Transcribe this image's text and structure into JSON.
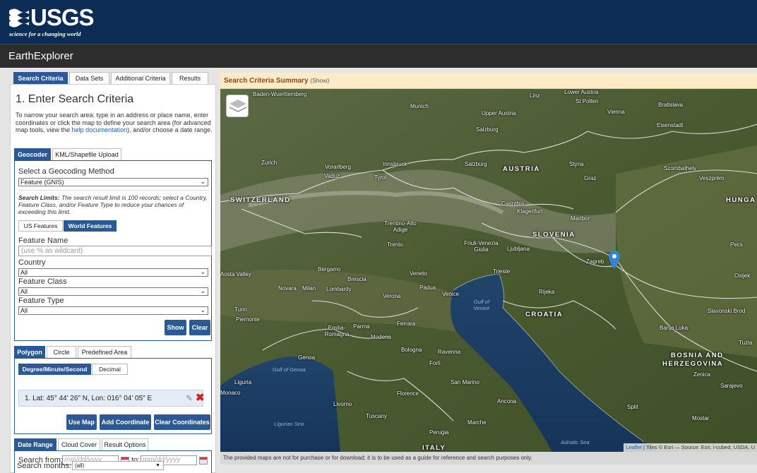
{
  "header": {
    "logo_text": "USGS",
    "logo_tagline": "science for a changing world",
    "app_title": "EarthExplorer"
  },
  "tabs": [
    {
      "label": "Search Criteria",
      "active": true
    },
    {
      "label": "Data Sets",
      "active": false
    },
    {
      "label": "Additional Criteria",
      "active": false
    },
    {
      "label": "Results",
      "active": false
    }
  ],
  "criteria": {
    "heading": "1. Enter Search Criteria",
    "intro_pre": "To narrow your search area: type in an address or place name, enter coordinates or click the map to define your search area (for advanced map tools, view the ",
    "intro_link": "help documentation",
    "intro_post": "), and/or choose a date range."
  },
  "geo_tabs": [
    {
      "label": "Geocoder",
      "active": true
    },
    {
      "label": "KML/Shapefile Upload",
      "active": false
    }
  ],
  "geocoder": {
    "method_label": "Select a Geocoding Method",
    "method_value": "Feature (GNIS)",
    "limit_bold": "Search Limits:",
    "limit_text": " The search result limit is 100 records; select a Country, Feature Class, and/or Feature Type to reduce your chances of exceeding this limit.",
    "feature_tabs": [
      {
        "label": "US Features",
        "active": false
      },
      {
        "label": "World Features",
        "active": true
      }
    ],
    "feature_name_label": "Feature Name",
    "feature_name_placeholder": "(use % as wildcard)",
    "country_label": "Country",
    "country_value": "All",
    "class_label": "Feature Class",
    "class_value": "All",
    "type_label": "Feature Type",
    "type_value": "All",
    "show_button": "Show",
    "clear_button": "Clear"
  },
  "area_tabs": [
    {
      "label": "Polygon",
      "active": true
    },
    {
      "label": "Circle",
      "active": false
    },
    {
      "label": "Predefined Area",
      "active": false
    }
  ],
  "polygon": {
    "format_tabs": [
      {
        "label": "Degree/Minute/Second",
        "active": true
      },
      {
        "label": "Decimal",
        "active": false
      }
    ],
    "coordinate": "1.  Lat: 45° 44' 26\" N, Lon: 016° 04' 05\" E",
    "use_map_button": "Use Map",
    "add_coordinate_button": "Add Coordinate",
    "clear_coordinates_button": "Clear Coordinates"
  },
  "date_tabs": [
    {
      "label": "Date Range",
      "active": true
    },
    {
      "label": "Cloud Cover",
      "active": false
    },
    {
      "label": "Result Options",
      "active": false
    }
  ],
  "date": {
    "search_from_label": "Search from:",
    "from_placeholder": "mm/dd/yyyy",
    "to_label": "to:",
    "to_placeholder": "mm/dd/yyyy",
    "months_label": "Search months:",
    "months_value": "(all)"
  },
  "map": {
    "summary_title": "Search Criteria Summary",
    "summary_show": "(Show)",
    "attribution_link": "Leaflet",
    "attribution_text": " | Tiles © Esri — Source: Esri, i-cubed, USDA, U",
    "footer_notice": "The provided maps are not for purchase or for download; it is to be used as a guide for reference and search purposes only.",
    "countries": [
      "AUSTRIA",
      "SWITZERLAND",
      "SLOVENIA",
      "CROATIA",
      "HUNGA",
      "BOSNIA AND",
      "HERZEGOVINA",
      "ITALY"
    ],
    "cities": [
      "Baden-Wuerttemberg",
      "Munich",
      "Upper Austria",
      "Salzburg",
      "Lower Austria",
      "St Polten",
      "Vienna",
      "Bratislava",
      "Eisenstadt",
      "Linz",
      "Zurich",
      "Vorarlberg",
      "Vaduz",
      "Tyrol",
      "Innsbruck",
      "Salzburg",
      "Styria",
      "Graz",
      "Szombathely",
      "Veszprém",
      "Carinthia",
      "Klagenfurt",
      "Maribor",
      "Trentino-Alto Adige",
      "Trento",
      "Friuli-Venezia Giulia",
      "Ljubljana",
      "Zagreb",
      "Bergamo",
      "Brescia",
      "Veneto",
      "Trieste",
      "Rijeka",
      "Novara",
      "Milan",
      "Lombardy",
      "Verona",
      "Padua",
      "Venice",
      "Turin",
      "Piemonte",
      "Emilia-Romagna",
      "Parma",
      "Modena",
      "Ferrara",
      "Bologna",
      "Ravenna",
      "Forlì",
      "San Marino",
      "Florence",
      "Livorno",
      "Tuscany",
      "Ancona",
      "Marche",
      "Perugia",
      "Genoa",
      "Liguria",
      "Monaco",
      "Banja Luka",
      "Zenica",
      "Sarajevo",
      "Split",
      "Mostar",
      "Pecs",
      "Osijek",
      "Slavonski Brod",
      "Tuzla",
      "Zurich",
      "Aosta Valley"
    ],
    "waters": [
      "Gulf of Genoa",
      "Gulf of Venice",
      "Ligurian Sea",
      "Adriatic Sea"
    ]
  },
  "colors": {
    "header_bg": "#0b2c54",
    "accent": "#2a5a96",
    "summary_bg": "#fdebc8",
    "pin": "#2f86d8",
    "delete": "#d81e1e"
  }
}
